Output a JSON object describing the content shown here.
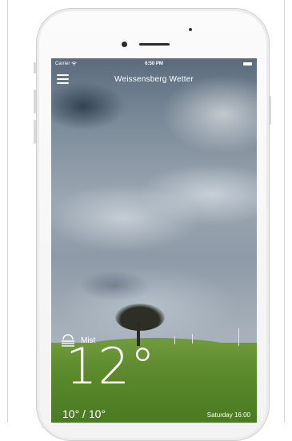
{
  "status_bar": {
    "carrier": "Carrier",
    "wifi_icon": "wifi-icon",
    "time": "6:50 PM",
    "battery_icon": "battery-icon"
  },
  "header": {
    "menu_icon": "hamburger-menu-icon",
    "title": "Weissensberg Wetter"
  },
  "weather": {
    "condition_icon": "mist-icon",
    "condition": "Mist",
    "temperature": "12°",
    "range": "10° / 10°",
    "datetime": "Saturday 16:00"
  },
  "colors": {
    "text": "#ffffff",
    "grass": "#5c8a2c",
    "sky": "#8e9aa7"
  }
}
